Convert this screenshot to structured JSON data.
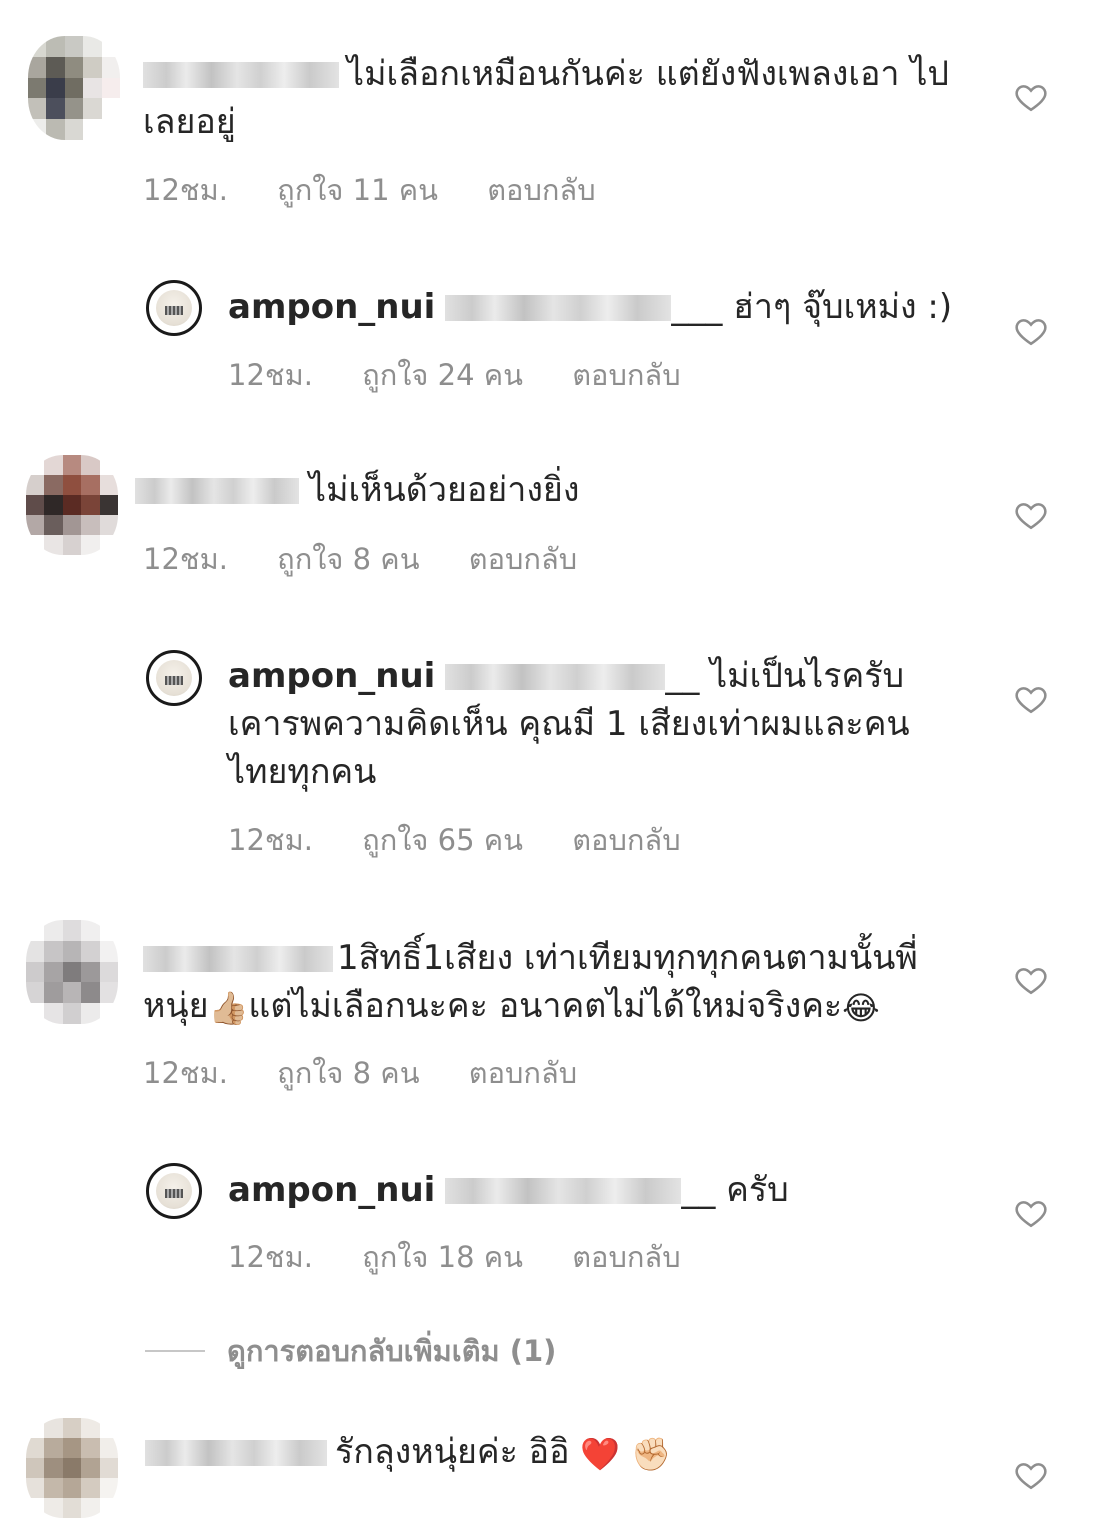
{
  "comments": [
    {
      "text": "ไม่เลือกเหมือนกันค่ะ แต่ยังฟังเพลงเอา ไปเลยอยู่",
      "time": "12ชม.",
      "likes": "ถูกใจ 11 คน",
      "reply": "ตอบกลับ"
    },
    {
      "username": "ampon_nui",
      "text": "___ ฮ่าๆ จุ๊บเหม่ง :)",
      "time": "12ชม.",
      "likes": "ถูกใจ 24 คน",
      "reply": "ตอบกลับ"
    },
    {
      "text": "ไม่เห็นด้วยอย่างยิ่ง",
      "time": "12ชม.",
      "likes": "ถูกใจ 8 คน",
      "reply": "ตอบกลับ"
    },
    {
      "username": "ampon_nui",
      "text_line1": "__ ไม่เป็นไรครับ",
      "text_line2": "เคารพความคิดเห็น คุณมี 1 เสียงเท่าผมและคน",
      "text_line3": "ไทยทุกคน",
      "time": "12ชม.",
      "likes": "ถูกใจ 65 คน",
      "reply": "ตอบกลับ"
    },
    {
      "text_line1": "1สิทธิ์1เสียง เท่าเทียมทุกทุกคนตามนั้นพี่",
      "text_line2a": "หนุ่ย",
      "emoji1": "👍🏼",
      "text_line2b": "แต่ไม่เลือกนะคะ อนาคตไม่ได้ใหม่จริงคะ",
      "emoji2": "😂",
      "time": "12ชม.",
      "likes": "ถูกใจ 8 คน",
      "reply": "ตอบกลับ"
    },
    {
      "username": "ampon_nui",
      "text": "__ ครับ",
      "time": "12ชม.",
      "likes": "ถูกใจ 18 คน",
      "reply": "ตอบกลับ"
    },
    {
      "text": "รักลุงหนุ่ยค่ะ อิอิ",
      "emoji1": "❤️",
      "emoji2": "✊🏻"
    }
  ],
  "view_more": "ดูการตอบกลับเพิ่มเติม (1)",
  "colors": {
    "text": "#262626",
    "meta": "#8e8e8e",
    "heart_outline": "#8e8e8e"
  },
  "icons": {
    "like": "heart-outline-icon"
  }
}
